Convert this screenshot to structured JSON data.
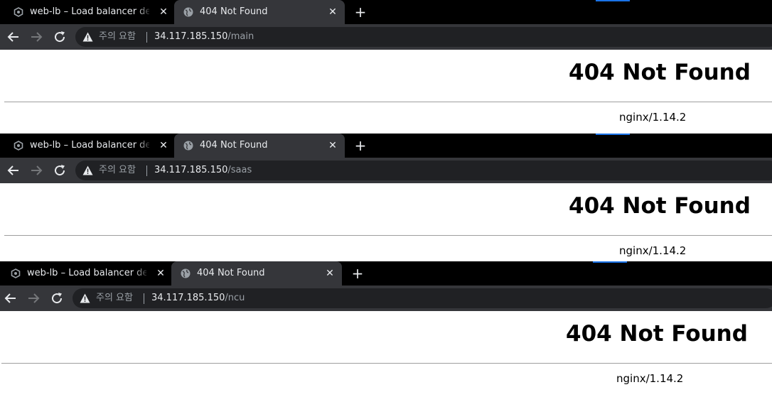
{
  "windows": [
    {
      "tabs": [
        {
          "title": "web-lb – Load balancer details – Network",
          "icon": "cloud-console-icon"
        },
        {
          "title": "404 Not Found",
          "icon": "globe-icon"
        }
      ],
      "address": {
        "security_label": "주의 요함",
        "host": "34.117.185.150",
        "path": "/main"
      },
      "page": {
        "heading": "404 Not Found",
        "server": "nginx/1.14.2"
      }
    },
    {
      "tabs": [
        {
          "title": "web-lb – Load balancer details – Network",
          "icon": "cloud-console-icon"
        },
        {
          "title": "404 Not Found",
          "icon": "globe-icon"
        }
      ],
      "address": {
        "security_label": "주의 요함",
        "host": "34.117.185.150",
        "path": "/saas"
      },
      "page": {
        "heading": "404 Not Found",
        "server": "nginx/1.14.2"
      }
    },
    {
      "tabs": [
        {
          "title": "web-lb – Load balancer details – Network",
          "icon": "cloud-console-icon"
        },
        {
          "title": "404 Not Found",
          "icon": "globe-icon"
        }
      ],
      "address": {
        "security_label": "주의 요함",
        "host": "34.117.185.150",
        "path": "/ncu"
      },
      "page": {
        "heading": "404 Not Found",
        "server": "nginx/1.14.2"
      }
    }
  ],
  "colors": {
    "tabbar": "#000000",
    "toolbar": "#35363a",
    "omnibox": "#202124",
    "accent": "#1a73e8"
  }
}
